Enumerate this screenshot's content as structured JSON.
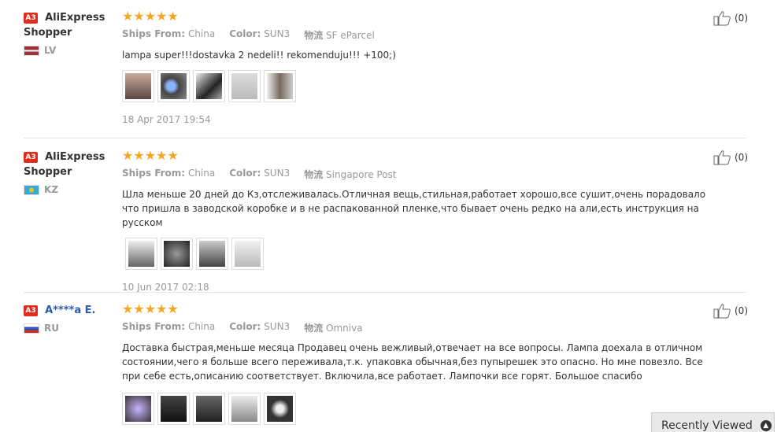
{
  "reviews": [
    {
      "badge": "A3",
      "name": "AliExpress Shopper",
      "country": "LV",
      "ships_label": "Ships From:",
      "ships_value": "China",
      "color_label": "Color:",
      "color_value": "SUN3",
      "logistics_label": "物流",
      "logistics_value": "SF eParcel",
      "text": "lampa super!!!dostavka 2 nedeli!! rekomenduju!!! +100;)",
      "date": "18 Apr 2017 19:54",
      "likes": "(0)",
      "photo_count": 5
    },
    {
      "badge": "A3",
      "name": "AliExpress Shopper",
      "country": "KZ",
      "ships_label": "Ships From:",
      "ships_value": "China",
      "color_label": "Color:",
      "color_value": "SUN3",
      "logistics_label": "物流",
      "logistics_value": "Singapore Post",
      "text": "Шла меньше 20 дней до Кз,отслеживалась.Отличная вещь,стильная,работает хорошо,все сушит,очень порадовало что пришла в заводской коробке и в не распакованной пленке,что бывает очень редко на али,есть инструкция на русском",
      "date": "10 Jun 2017 02:18",
      "likes": "(0)",
      "photo_count": 4
    },
    {
      "badge": "A3",
      "name": "A****a E.",
      "country": "RU",
      "ships_label": "Ships From:",
      "ships_value": "China",
      "color_label": "Color:",
      "color_value": "SUN3",
      "logistics_label": "物流",
      "logistics_value": "Omniva",
      "text": "Доставка быстрая,меньше месяца Продавец очень вежливый,отвечает на все вопросы. Лампа доехала в отличном состоянии,чего я больше всего переживала,т.к. упаковка обычная,без пупырешек это опасно. Но мне повезло. Все при себе есть,описанию соответствует. Включила,все работает. Лампочки все горят. Большое спасибо",
      "likes": "(0)",
      "photo_count": 5
    }
  ],
  "stars": "★★★★★",
  "recently_viewed": "Recently Viewed",
  "colors": {
    "star": "#f5a623",
    "badge": "#e02d1c",
    "muted": "#999999",
    "link_blue": "#2a5db0"
  }
}
